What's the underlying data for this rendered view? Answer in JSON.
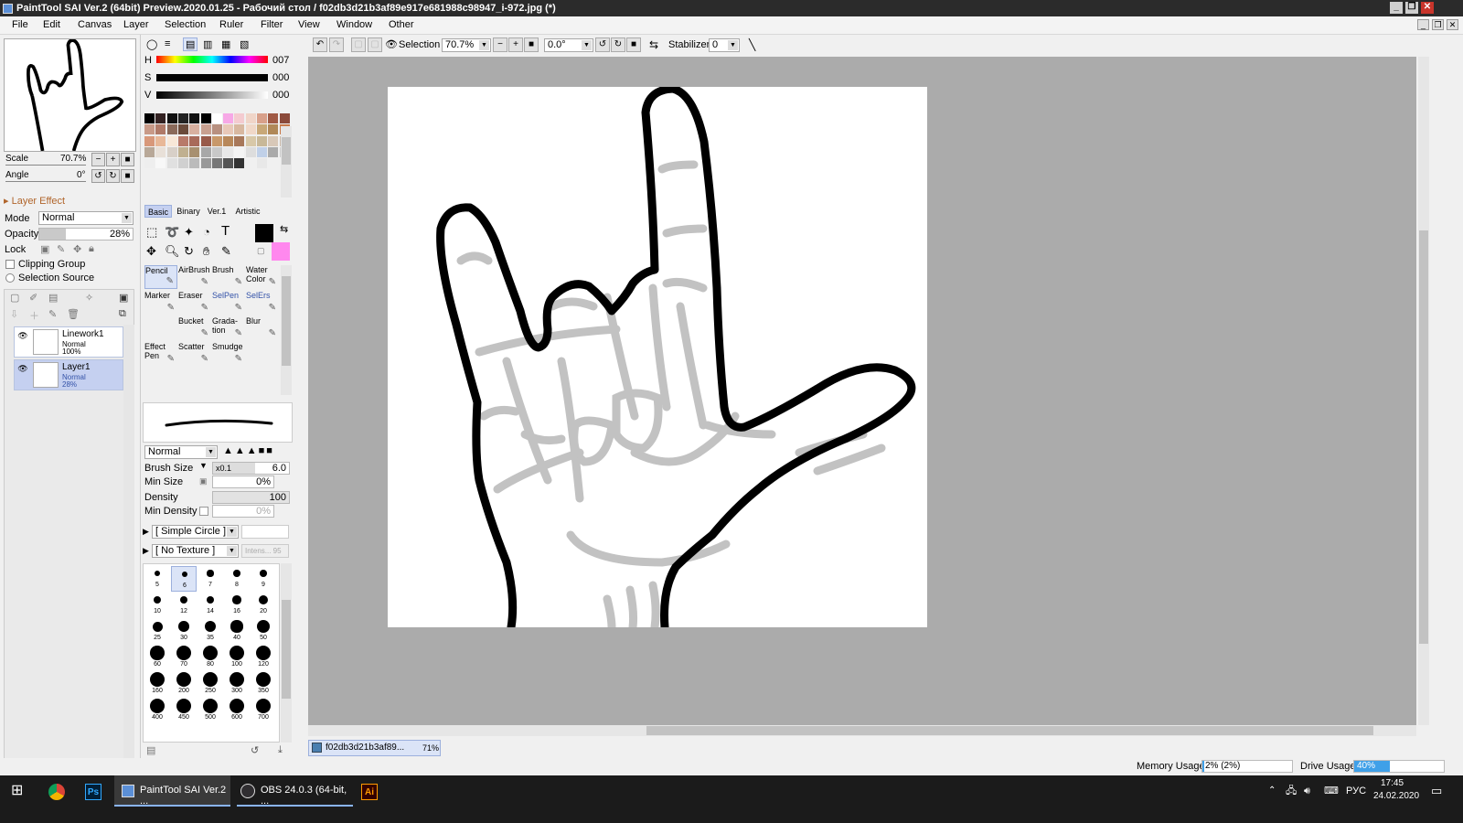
{
  "window": {
    "title": "PaintTool SAI Ver.2 (64bit) Preview.2020.01.25 - Рабочий стол / f02db3d21b3af89e917e681988c98947_i-972.jpg (*)",
    "controls": [
      "_",
      "❐",
      "✕"
    ]
  },
  "menu": [
    "File",
    "Edit",
    "Canvas",
    "Layer",
    "Selection",
    "Ruler",
    "Filter",
    "View",
    "Window",
    "Other"
  ],
  "navigator": {
    "scale_label": "Scale",
    "scale_value": "70.7%",
    "angle_label": "Angle",
    "angle_value": "0°"
  },
  "layer_panel": {
    "section": "Layer Effect",
    "mode_label": "Mode",
    "mode_value": "Normal",
    "opacity_label": "Opacity",
    "opacity_value": "28%",
    "opacity_level": 0.28,
    "lock_label": "Lock",
    "clipping_label": "Clipping Group",
    "selection_source_label": "Selection Source",
    "layers": [
      {
        "name": "Linework1",
        "mode": "Normal",
        "opacity": "100%"
      },
      {
        "name": "Layer1",
        "mode": "Normal",
        "opacity": "28%"
      }
    ]
  },
  "color": {
    "h_label": "H",
    "h_value": "007",
    "s_label": "S",
    "s_value": "000",
    "v_label": "V",
    "v_value": "000",
    "primary": "#000000",
    "secondary": "#ff88ee"
  },
  "tool_tabs": [
    "Basic",
    "Binary",
    "Ver.1",
    "Artistic"
  ],
  "tools": [
    {
      "name": "Pencil",
      "icon": "pencil-icon"
    },
    {
      "name": "AirBrush",
      "icon": "airbrush-icon"
    },
    {
      "name": "Brush",
      "icon": "brush-icon"
    },
    {
      "name": "Water Color",
      "icon": "watercolor-icon"
    },
    {
      "name": "Marker",
      "icon": "marker-icon"
    },
    {
      "name": "Eraser",
      "icon": "eraser-icon"
    },
    {
      "name": "SelPen",
      "icon": "selpen-icon"
    },
    {
      "name": "SelErs",
      "icon": "selers-icon"
    },
    {
      "name": "",
      "icon": ""
    },
    {
      "name": "Bucket",
      "icon": "bucket-icon"
    },
    {
      "name": "Grada-tion",
      "icon": "gradation-icon"
    },
    {
      "name": "Blur",
      "icon": "blur-icon"
    },
    {
      "name": "Effect Pen",
      "icon": "effect-pen-icon"
    },
    {
      "name": "Scatter",
      "icon": "scatter-icon"
    },
    {
      "name": "Smudge",
      "icon": "smudge-icon"
    }
  ],
  "brush": {
    "blend_mode": "Normal",
    "size_label": "Brush Size",
    "size_mult": "x0.1",
    "size_value": "6.0",
    "min_size_label": "Min Size",
    "min_size_value": "0%",
    "density_label": "Density",
    "density_value": "100",
    "min_density_label": "Min Density",
    "min_density_value": "0%",
    "shape": "[ Simple Circle ]",
    "texture": "[ No Texture ]",
    "texture_strength": "Intens... 95",
    "sizes": [
      "5",
      "6",
      "7",
      "8",
      "9",
      "10",
      "12",
      "14",
      "16",
      "20",
      "25",
      "30",
      "35",
      "40",
      "50",
      "60",
      "70",
      "80",
      "100",
      "120",
      "160",
      "200",
      "250",
      "300",
      "350",
      "400",
      "450",
      "500",
      "600",
      "700"
    ]
  },
  "canvas_toolbar": {
    "selection_label": "Selection",
    "zoom": "70.7%",
    "angle": "0.0°",
    "stabilizer_label": "Stabilizer",
    "stabilizer_value": "0"
  },
  "document_tab": {
    "name": "f02db3d21b3af89...",
    "zoom": "71%"
  },
  "status": {
    "memory_label": "Memory Usage",
    "memory_value": "2% (2%)",
    "memory_level": 0.02,
    "drive_label": "Drive Usage",
    "drive_value": "40%",
    "drive_level": 0.4
  },
  "taskbar": {
    "items": [
      "PaintTool SAI Ver.2 ...",
      "OBS 24.0.3 (64-bit, ..."
    ],
    "lang": "РУС",
    "time": "17:45",
    "date": "24.02.2020"
  }
}
